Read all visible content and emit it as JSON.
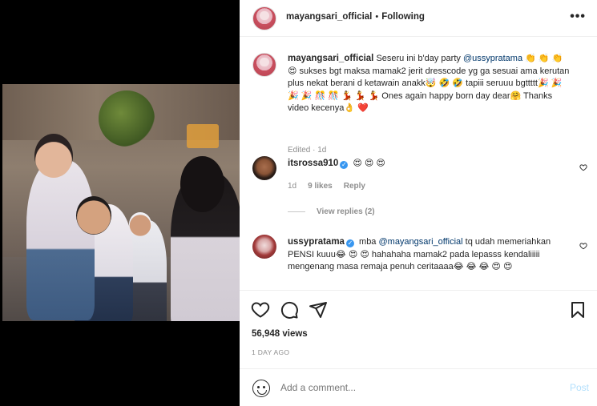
{
  "post": {
    "author": "mayangsari_official",
    "follow_status": "Following",
    "more_icon": "more-horizontal-icon"
  },
  "caption": {
    "username": "mayangsari_official",
    "text_part1": " Seseru ini b'day party ",
    "mention": "@ussypratama",
    "text_part2": " 👏 👏 👏 😍 sukses bgt maksa mamak2 jerit dresscode yg ga sesuai ama kerutan plus nekat berani d ketawain anakk🤯 🤣 🤣  tapiii seruuu bgttttt🎉 🎉 🎉 🎉 🎊 🎊 💃 💃 💃  Ones again happy born day dear🤗 Thanks video kecenya👌 ❤️",
    "meta": "Edited · 1d"
  },
  "comments": [
    {
      "username": "itsrossa910",
      "verified": true,
      "text": " 😍 😍 😍",
      "time": "1d",
      "likes": "9 likes",
      "reply": "Reply",
      "view_replies": "View replies (2)"
    },
    {
      "username": "ussypratama",
      "verified": true,
      "text_part1": " mba ",
      "mention": "@mayangsari_official",
      "text_part2": " tq udah memeriahkan PENSI kuuu😂 😍 😍  hahahaha mamak2 pada lepasss kendaliiiii mengenang masa remaja penuh ceritaaaa😂 😂 😂 😍 😍"
    }
  ],
  "actions": {
    "like_icon": "heart-icon",
    "comment_icon": "comment-icon",
    "share_icon": "share-icon",
    "save_icon": "bookmark-icon",
    "views": "56,948 views",
    "posted_ago": "1 DAY AGO"
  },
  "add_comment": {
    "placeholder": "Add a comment...",
    "post_label": "Post",
    "emoji_icon": "emoji-icon"
  },
  "colors": {
    "link": "#00376b",
    "verified": "#3897f0",
    "post_disabled": "#b2dffc",
    "meta_gray": "#8e8e8e"
  }
}
